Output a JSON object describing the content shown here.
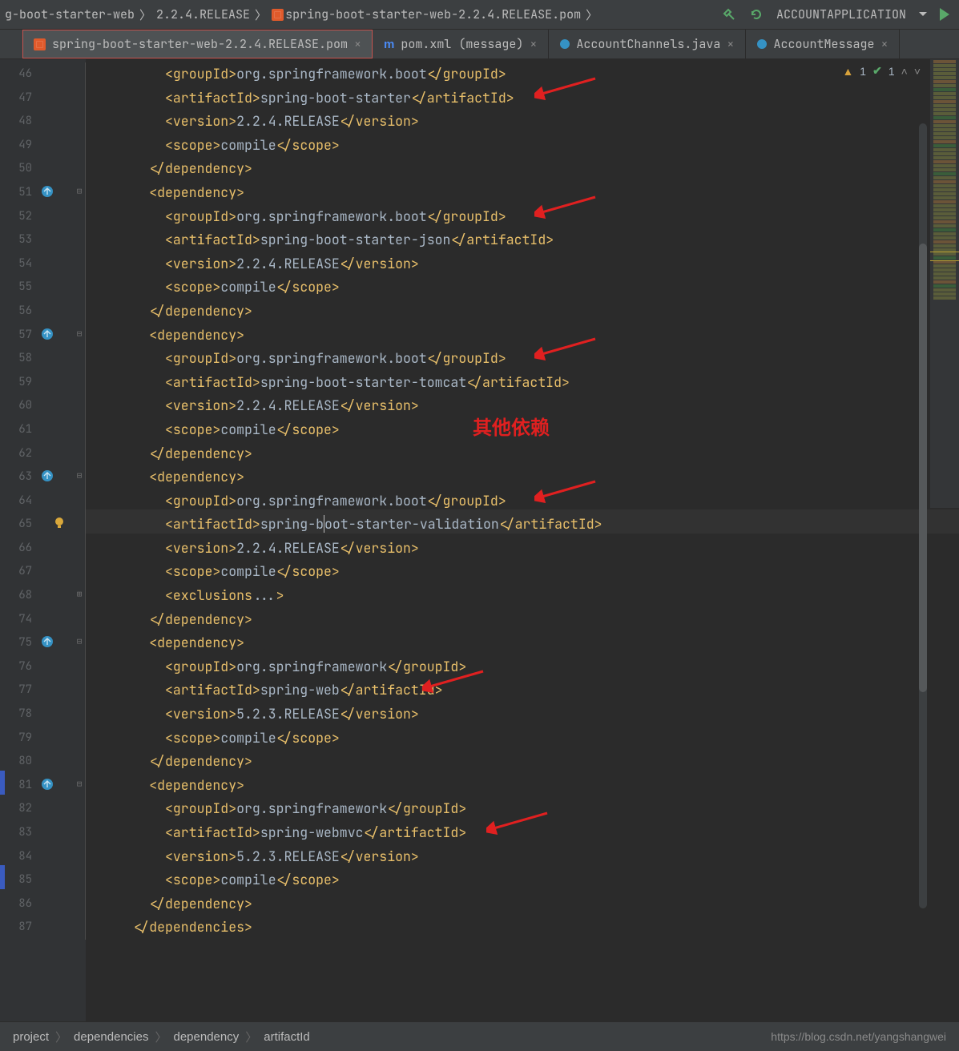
{
  "topbar": {
    "crumbs": [
      "g-boot-starter-web",
      "2.2.4.RELEASE",
      "spring-boot-starter-web-2.2.4.RELEASE.pom"
    ],
    "run_config": "ACCOUNTAPPLICATION"
  },
  "tabs": [
    {
      "label": "spring-boot-starter-web-2.2.4.RELEASE.pom",
      "type": "pom",
      "active": true
    },
    {
      "label": "pom.xml (message)",
      "type": "maven",
      "active": false
    },
    {
      "label": "AccountChannels.java",
      "type": "java",
      "active": false
    },
    {
      "label": "AccountMessage",
      "type": "java",
      "active": false
    }
  ],
  "inspection": {
    "warn": "1",
    "ok": "1"
  },
  "lines": [
    {
      "n": 46,
      "ind": 4,
      "c": [
        [
          "t",
          "<groupId>"
        ],
        [
          "v",
          "org.springframework.boot"
        ],
        [
          "t",
          "</groupId>"
        ]
      ]
    },
    {
      "n": 47,
      "ind": 4,
      "c": [
        [
          "t",
          "<artifactId>"
        ],
        [
          "v",
          "spring-boot-starter"
        ],
        [
          "t",
          "</artifactId>"
        ]
      ]
    },
    {
      "n": 48,
      "ind": 4,
      "c": [
        [
          "t",
          "<version>"
        ],
        [
          "v",
          "2.2.4.RELEASE"
        ],
        [
          "t",
          "</version>"
        ]
      ]
    },
    {
      "n": 49,
      "ind": 4,
      "c": [
        [
          "t",
          "<scope>"
        ],
        [
          "v",
          "compile"
        ],
        [
          "t",
          "</scope>"
        ]
      ]
    },
    {
      "n": 50,
      "ind": 3,
      "c": [
        [
          "t",
          "</dependency>"
        ]
      ]
    },
    {
      "n": 51,
      "ind": 3,
      "c": [
        [
          "t",
          "<dependency>"
        ]
      ],
      "mark": "dep",
      "fold": "-"
    },
    {
      "n": 52,
      "ind": 4,
      "c": [
        [
          "t",
          "<groupId>"
        ],
        [
          "v",
          "org.springframework.boot"
        ],
        [
          "t",
          "</groupId>"
        ]
      ]
    },
    {
      "n": 53,
      "ind": 4,
      "c": [
        [
          "t",
          "<artifactId>"
        ],
        [
          "v",
          "spring-boot-starter-json"
        ],
        [
          "t",
          "</artifactId>"
        ]
      ]
    },
    {
      "n": 54,
      "ind": 4,
      "c": [
        [
          "t",
          "<version>"
        ],
        [
          "v",
          "2.2.4.RELEASE"
        ],
        [
          "t",
          "</version>"
        ]
      ]
    },
    {
      "n": 55,
      "ind": 4,
      "c": [
        [
          "t",
          "<scope>"
        ],
        [
          "v",
          "compile"
        ],
        [
          "t",
          "</scope>"
        ]
      ]
    },
    {
      "n": 56,
      "ind": 3,
      "c": [
        [
          "t",
          "</dependency>"
        ]
      ]
    },
    {
      "n": 57,
      "ind": 3,
      "c": [
        [
          "t",
          "<dependency>"
        ]
      ],
      "mark": "dep",
      "fold": "-"
    },
    {
      "n": 58,
      "ind": 4,
      "c": [
        [
          "t",
          "<groupId>"
        ],
        [
          "v",
          "org.springframework.boot"
        ],
        [
          "t",
          "</groupId>"
        ]
      ]
    },
    {
      "n": 59,
      "ind": 4,
      "c": [
        [
          "t",
          "<artifactId>"
        ],
        [
          "v",
          "spring-boot-starter-tomcat"
        ],
        [
          "t",
          "</artifactId>"
        ]
      ]
    },
    {
      "n": 60,
      "ind": 4,
      "c": [
        [
          "t",
          "<version>"
        ],
        [
          "v",
          "2.2.4.RELEASE"
        ],
        [
          "t",
          "</version>"
        ]
      ]
    },
    {
      "n": 61,
      "ind": 4,
      "c": [
        [
          "t",
          "<scope>"
        ],
        [
          "v",
          "compile"
        ],
        [
          "t",
          "</scope>"
        ]
      ]
    },
    {
      "n": 62,
      "ind": 3,
      "c": [
        [
          "t",
          "</dependency>"
        ]
      ]
    },
    {
      "n": 63,
      "ind": 3,
      "c": [
        [
          "t",
          "<dependency>"
        ]
      ],
      "mark": "dep",
      "fold": "-"
    },
    {
      "n": 64,
      "ind": 4,
      "c": [
        [
          "t",
          "<groupId>"
        ],
        [
          "v",
          "org.springframework.boot"
        ],
        [
          "t",
          "</groupId>"
        ]
      ]
    },
    {
      "n": 65,
      "ind": 4,
      "c": [
        [
          "t",
          "<artifactId>"
        ],
        [
          "v",
          "spring-b"
        ],
        [
          "caret",
          ""
        ],
        [
          "v",
          "oot-starter-validation"
        ],
        [
          "t",
          "</artifactId>"
        ]
      ],
      "mark": "bulb",
      "hl": true
    },
    {
      "n": 66,
      "ind": 4,
      "c": [
        [
          "t",
          "<version>"
        ],
        [
          "v",
          "2.2.4.RELEASE"
        ],
        [
          "t",
          "</version>"
        ]
      ]
    },
    {
      "n": 67,
      "ind": 4,
      "c": [
        [
          "t",
          "<scope>"
        ],
        [
          "v",
          "compile"
        ],
        [
          "t",
          "</scope>"
        ]
      ]
    },
    {
      "n": 68,
      "ind": 4,
      "c": [
        [
          "t",
          "<exclusions"
        ],
        [
          "v",
          "..."
        ],
        [
          "t",
          ">"
        ]
      ],
      "fold": "+"
    },
    {
      "n": 74,
      "ind": 3,
      "c": [
        [
          "t",
          "</dependency>"
        ]
      ]
    },
    {
      "n": 75,
      "ind": 3,
      "c": [
        [
          "t",
          "<dependency>"
        ]
      ],
      "mark": "dep",
      "fold": "-"
    },
    {
      "n": 76,
      "ind": 4,
      "c": [
        [
          "t",
          "<groupId>"
        ],
        [
          "v",
          "org.springframework"
        ],
        [
          "t",
          "</groupId>"
        ]
      ]
    },
    {
      "n": 77,
      "ind": 4,
      "c": [
        [
          "t",
          "<artifactId>"
        ],
        [
          "v",
          "spring-web"
        ],
        [
          "t",
          "</artifactId>"
        ]
      ]
    },
    {
      "n": 78,
      "ind": 4,
      "c": [
        [
          "t",
          "<version>"
        ],
        [
          "v",
          "5.2.3.RELEASE"
        ],
        [
          "t",
          "</version>"
        ]
      ]
    },
    {
      "n": 79,
      "ind": 4,
      "c": [
        [
          "t",
          "<scope>"
        ],
        [
          "v",
          "compile"
        ],
        [
          "t",
          "</scope>"
        ]
      ]
    },
    {
      "n": 80,
      "ind": 3,
      "c": [
        [
          "t",
          "</dependency>"
        ]
      ]
    },
    {
      "n": 81,
      "ind": 3,
      "c": [
        [
          "t",
          "<dependency>"
        ]
      ],
      "mark": "dep",
      "fold": "-"
    },
    {
      "n": 82,
      "ind": 4,
      "c": [
        [
          "t",
          "<groupId>"
        ],
        [
          "v",
          "org.springframework"
        ],
        [
          "t",
          "</groupId>"
        ]
      ]
    },
    {
      "n": 83,
      "ind": 4,
      "c": [
        [
          "t",
          "<artifactId>"
        ],
        [
          "v",
          "spring-webmvc"
        ],
        [
          "t",
          "</artifactId>"
        ]
      ]
    },
    {
      "n": 84,
      "ind": 4,
      "c": [
        [
          "t",
          "<version>"
        ],
        [
          "v",
          "5.2.3.RELEASE"
        ],
        [
          "t",
          "</version>"
        ]
      ]
    },
    {
      "n": 85,
      "ind": 4,
      "c": [
        [
          "t",
          "<scope>"
        ],
        [
          "v",
          "compile"
        ],
        [
          "t",
          "</scope>"
        ]
      ]
    },
    {
      "n": 86,
      "ind": 3,
      "c": [
        [
          "t",
          "</dependency>"
        ]
      ]
    },
    {
      "n": 87,
      "ind": 2,
      "c": [
        [
          "t",
          "</dependencies>"
        ]
      ]
    }
  ],
  "annotation": {
    "text": "其他依赖"
  },
  "arrows": [
    {
      "line": 1
    },
    {
      "line": 6
    },
    {
      "line": 12
    },
    {
      "line": 18
    },
    {
      "line": 26
    },
    {
      "line": 32
    }
  ],
  "bottom_crumbs": [
    "project",
    "dependencies",
    "dependency",
    "artifactId"
  ],
  "blog": "https://blog.csdn.net/yangshangwei"
}
